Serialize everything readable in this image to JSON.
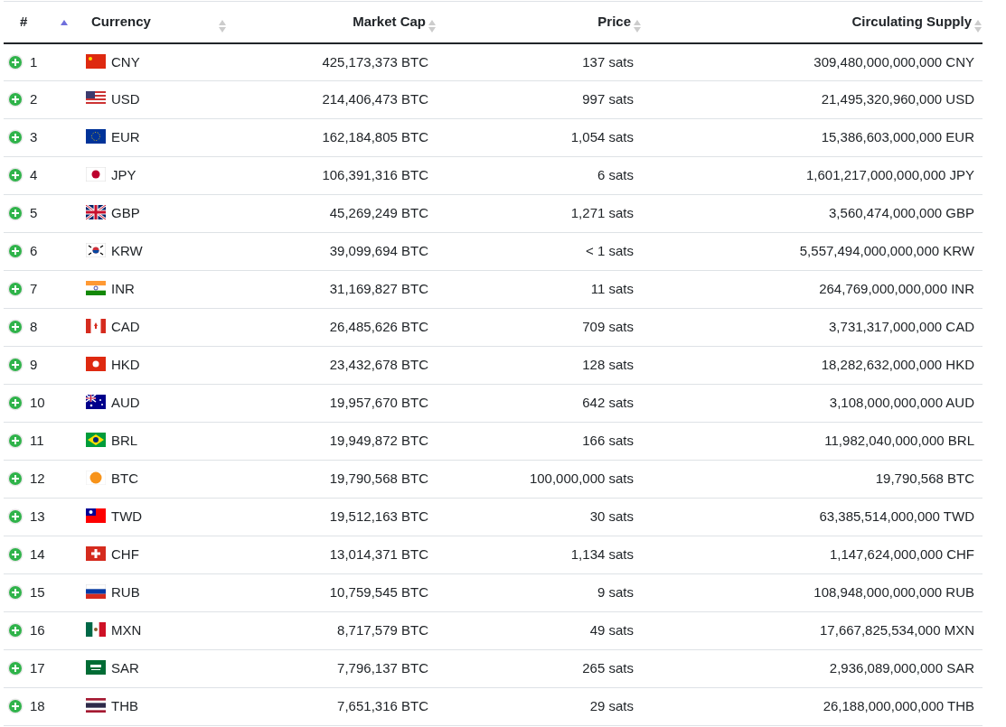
{
  "table": {
    "columns": [
      {
        "label": "#",
        "sorted": true
      },
      {
        "label": "Currency",
        "sorted": false
      },
      {
        "label": "Market Cap",
        "sorted": false
      },
      {
        "label": "Price",
        "sorted": false
      },
      {
        "label": "Circulating Supply",
        "sorted": false
      }
    ],
    "rows": [
      {
        "rank": "1",
        "currency": "CNY",
        "market_cap": "425,173,373 BTC",
        "price": "137 sats",
        "supply": "309,480,000,000,000 CNY"
      },
      {
        "rank": "2",
        "currency": "USD",
        "market_cap": "214,406,473 BTC",
        "price": "997 sats",
        "supply": "21,495,320,960,000 USD"
      },
      {
        "rank": "3",
        "currency": "EUR",
        "market_cap": "162,184,805 BTC",
        "price": "1,054 sats",
        "supply": "15,386,603,000,000 EUR"
      },
      {
        "rank": "4",
        "currency": "JPY",
        "market_cap": "106,391,316 BTC",
        "price": "6 sats",
        "supply": "1,601,217,000,000,000 JPY"
      },
      {
        "rank": "5",
        "currency": "GBP",
        "market_cap": "45,269,249 BTC",
        "price": "1,271 sats",
        "supply": "3,560,474,000,000 GBP"
      },
      {
        "rank": "6",
        "currency": "KRW",
        "market_cap": "39,099,694 BTC",
        "price": "< 1 sats",
        "supply": "5,557,494,000,000,000 KRW"
      },
      {
        "rank": "7",
        "currency": "INR",
        "market_cap": "31,169,827 BTC",
        "price": "11 sats",
        "supply": "264,769,000,000,000 INR"
      },
      {
        "rank": "8",
        "currency": "CAD",
        "market_cap": "26,485,626 BTC",
        "price": "709 sats",
        "supply": "3,731,317,000,000 CAD"
      },
      {
        "rank": "9",
        "currency": "HKD",
        "market_cap": "23,432,678 BTC",
        "price": "128 sats",
        "supply": "18,282,632,000,000 HKD"
      },
      {
        "rank": "10",
        "currency": "AUD",
        "market_cap": "19,957,670 BTC",
        "price": "642 sats",
        "supply": "3,108,000,000,000 AUD"
      },
      {
        "rank": "11",
        "currency": "BRL",
        "market_cap": "19,949,872 BTC",
        "price": "166 sats",
        "supply": "11,982,040,000,000 BRL"
      },
      {
        "rank": "12",
        "currency": "BTC",
        "market_cap": "19,790,568 BTC",
        "price": "100,000,000 sats",
        "supply": "19,790,568 BTC"
      },
      {
        "rank": "13",
        "currency": "TWD",
        "market_cap": "19,512,163 BTC",
        "price": "30 sats",
        "supply": "63,385,514,000,000 TWD"
      },
      {
        "rank": "14",
        "currency": "CHF",
        "market_cap": "13,014,371 BTC",
        "price": "1,134 sats",
        "supply": "1,147,624,000,000 CHF"
      },
      {
        "rank": "15",
        "currency": "RUB",
        "market_cap": "10,759,545 BTC",
        "price": "9 sats",
        "supply": "108,948,000,000,000 RUB"
      },
      {
        "rank": "16",
        "currency": "MXN",
        "market_cap": "8,717,579 BTC",
        "price": "49 sats",
        "supply": "17,667,825,534,000 MXN"
      },
      {
        "rank": "17",
        "currency": "SAR",
        "market_cap": "7,796,137 BTC",
        "price": "265 sats",
        "supply": "2,936,089,000,000 SAR"
      },
      {
        "rank": "18",
        "currency": "THB",
        "market_cap": "7,651,316 BTC",
        "price": "29 sats",
        "supply": "26,188,000,000,000 THB"
      }
    ]
  }
}
